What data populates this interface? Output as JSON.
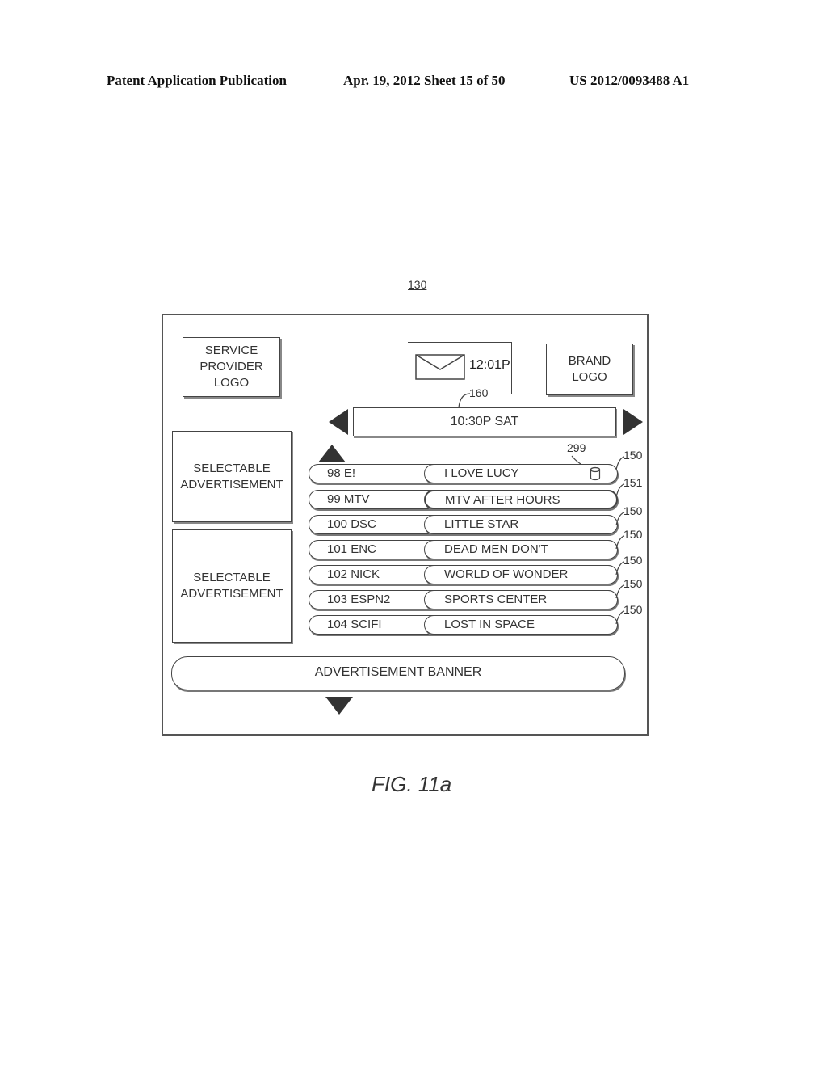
{
  "header": {
    "publication": "Patent Application Publication",
    "date_sheet": "Apr. 19, 2012  Sheet 15 of 50",
    "patent_number": "US 2012/0093488 A1"
  },
  "figure": {
    "ref_number": "130",
    "caption": "FIG. 11a"
  },
  "screen": {
    "service_provider_logo": [
      "SERVICE",
      "PROVIDER",
      "LOGO"
    ],
    "brand_logo": [
      "BRAND",
      "LOGO"
    ],
    "clock": "12:01P",
    "mail_icon": "envelope-icon",
    "time_bar": {
      "label": "10:30P SAT",
      "ref": "160"
    },
    "ads": [
      {
        "line1": "SELECTABLE",
        "line2": "ADVERTISEMENT"
      },
      {
        "line1": "SELECTABLE",
        "line2": "ADVERTISEMENT"
      }
    ],
    "banner": "ADVERTISEMENT BANNER",
    "reminder_ref": "299",
    "listings": [
      {
        "channel": "98 E!",
        "program": "I LOVE LUCY",
        "ref": "150",
        "reminder": true,
        "selected": false
      },
      {
        "channel": "99 MTV",
        "program": "MTV AFTER HOURS",
        "ref": "151",
        "reminder": false,
        "selected": true
      },
      {
        "channel": "100 DSC",
        "program": "LITTLE STAR",
        "ref": "150",
        "reminder": false,
        "selected": false
      },
      {
        "channel": "101 ENC",
        "program": "DEAD MEN DON'T",
        "ref": "150",
        "reminder": false,
        "selected": false
      },
      {
        "channel": "102 NICK",
        "program": "WORLD OF WONDER",
        "ref": "150",
        "reminder": false,
        "selected": false
      },
      {
        "channel": "103 ESPN2",
        "program": "SPORTS CENTER",
        "ref": "150",
        "reminder": false,
        "selected": false
      },
      {
        "channel": "104 SCIFI",
        "program": "LOST IN SPACE",
        "ref": "150",
        "reminder": false,
        "selected": false
      }
    ]
  }
}
